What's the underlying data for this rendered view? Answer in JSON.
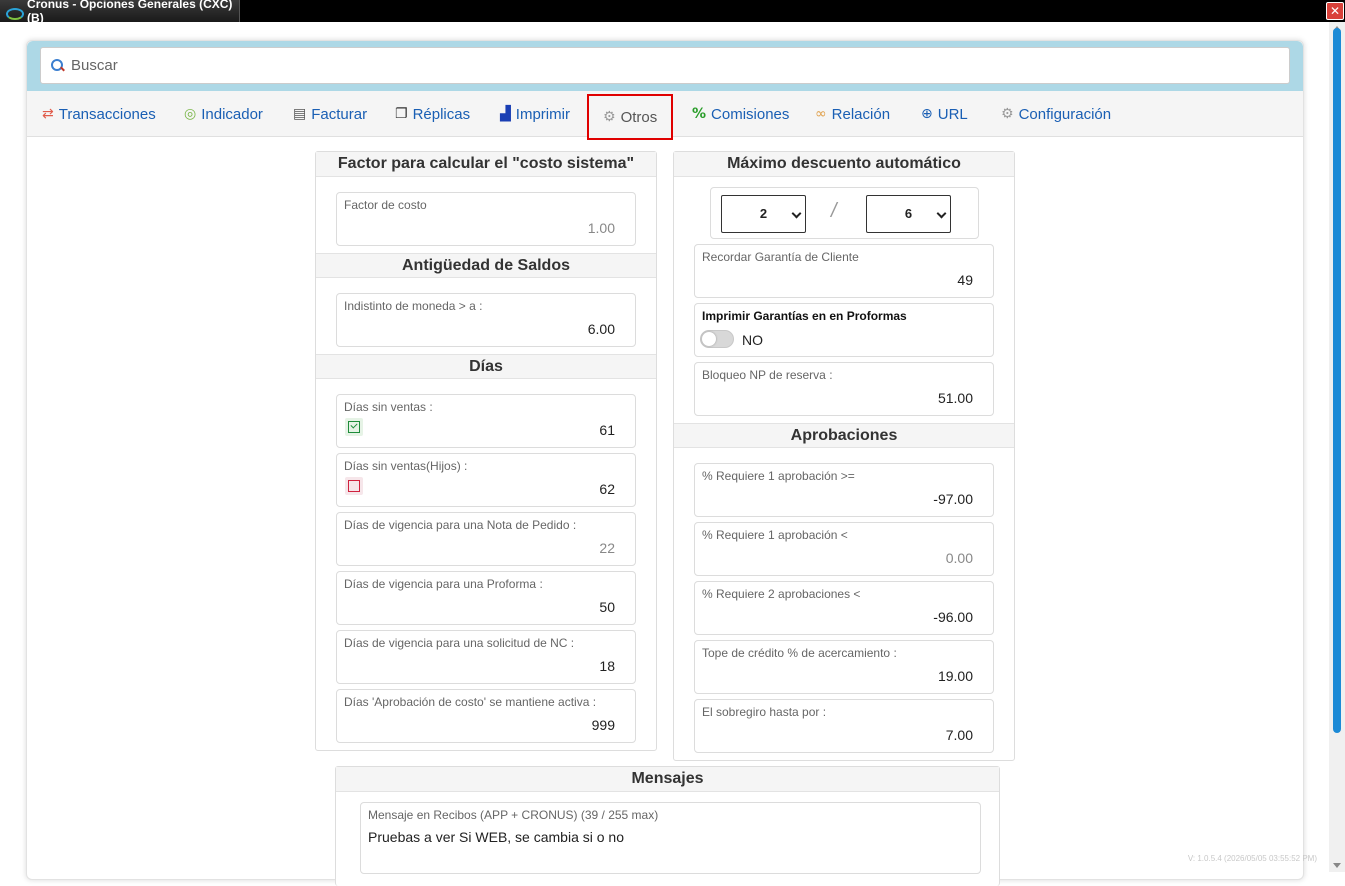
{
  "window": {
    "title": "Cronus - Opciones Generales (CXC) (B)"
  },
  "search": {
    "placeholder": "Buscar"
  },
  "tabs": [
    {
      "label": "Transacciones",
      "icon": "arrows-swap-icon",
      "color": "#e05c4b"
    },
    {
      "label": "Indicador",
      "icon": "target-icon",
      "color": "#7ab648"
    },
    {
      "label": "Facturar",
      "icon": "document-icon",
      "color": "#555555"
    },
    {
      "label": "Réplicas",
      "icon": "copy-icon",
      "color": "#333333"
    },
    {
      "label": "Imprimir",
      "icon": "chart-icon",
      "color": "#1a3fb4"
    },
    {
      "label": "Otros",
      "icon": "gears-icon",
      "color": "#999999"
    },
    {
      "label": "Comisiones",
      "icon": "percent-icon",
      "color": "#2a9d2a"
    },
    {
      "label": "Relación",
      "icon": "link-icon",
      "color": "#e0a04b"
    },
    {
      "label": "URL",
      "icon": "globe-icon",
      "color": "#1a5fb4"
    },
    {
      "label": "Configuración",
      "icon": "gear-icon",
      "color": "#999999"
    }
  ],
  "left": {
    "cost_title": "Factor para calcular el \"costo sistema\"",
    "cost_factor": {
      "label": "Factor de costo",
      "value": "1.00"
    },
    "aging_title": "Antigüedad de Saldos",
    "aging": {
      "label": "Indistinto de moneda > a :",
      "value": "6.00"
    },
    "days_title": "Días",
    "days": [
      {
        "label": "Días sin ventas :",
        "value": "61",
        "checked": true
      },
      {
        "label": "Días sin ventas(Hijos) :",
        "value": "62",
        "checked": false
      },
      {
        "label": "Días de vigencia para una Nota de Pedido :",
        "value": "22"
      },
      {
        "label": "Días de vigencia para una Proforma :",
        "value": "50"
      },
      {
        "label": "Días de vigencia para una solicitud de NC :",
        "value": "18"
      },
      {
        "label": "Días 'Aprobación de costo' se mantiene activa :",
        "value": "999"
      }
    ]
  },
  "right": {
    "discount_title": "Máximo descuento automático",
    "discount": {
      "left": "2",
      "separator": "/",
      "right": "6"
    },
    "guarantee": {
      "label": "Recordar Garantía de Cliente",
      "value": "49"
    },
    "print_guarantee": {
      "label": "Imprimir Garantías en en Proformas",
      "state": "NO"
    },
    "reserve_block": {
      "label": "Bloqueo NP de reserva :",
      "value": "51.00"
    },
    "approvals_title": "Aprobaciones",
    "approvals": [
      {
        "label": "% Requiere 1 aprobación >=",
        "value": "-97.00"
      },
      {
        "label": "% Requiere 1 aprobación <",
        "value": "0.00"
      },
      {
        "label": "% Requiere 2 aprobaciones <",
        "value": "-96.00"
      },
      {
        "label": "Tope de crédito % de acercamiento :",
        "value": "19.00"
      },
      {
        "label": "El sobregiro hasta por :",
        "value": "7.00"
      }
    ]
  },
  "messages": {
    "title": "Mensajes",
    "label": "Mensaje en Recibos (APP + CRONUS) (39 / 255 max)",
    "value": "Pruebas a ver Si WEB, se cambia si o no"
  },
  "footer": {
    "version": "V: 1.0.5.4 (2026/05/05 03:55:52 PM)"
  }
}
